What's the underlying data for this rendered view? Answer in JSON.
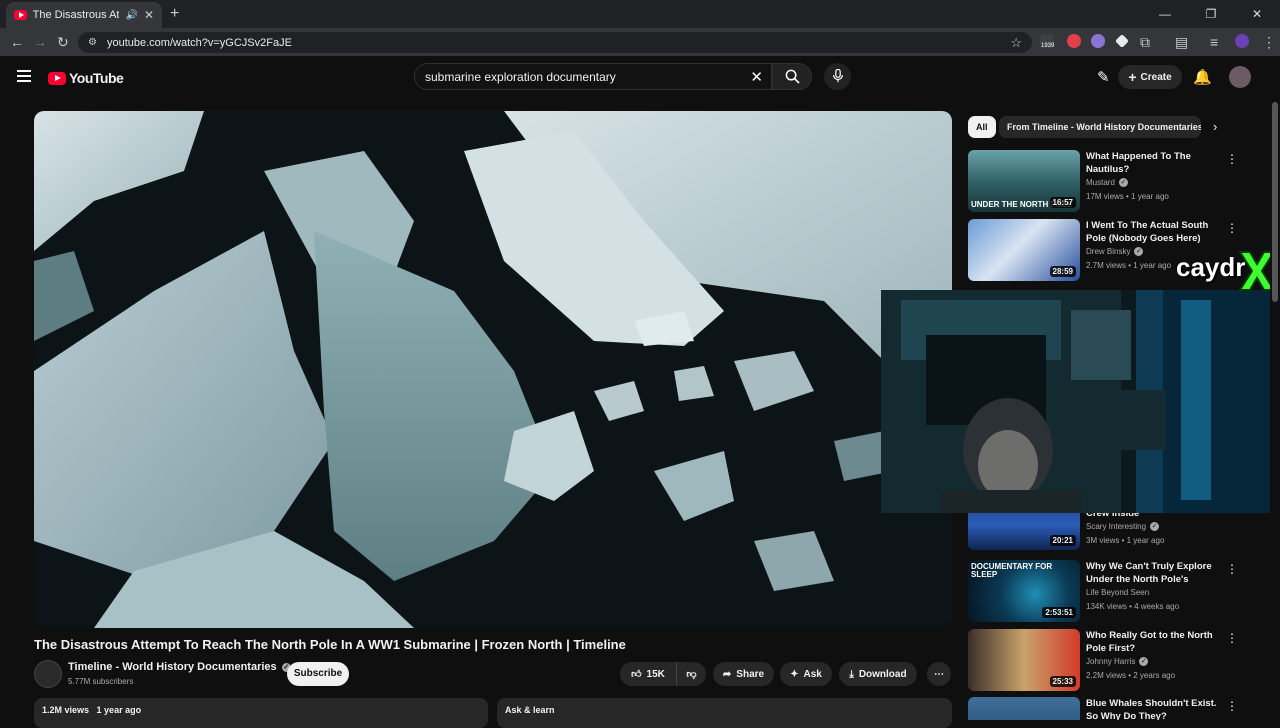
{
  "browser": {
    "tab_title": "The Disastrous Attempt To",
    "url": "youtube.com/watch?v=yGCJSv2FaJE",
    "ext_badge": "1939"
  },
  "header": {
    "logo_text": "YouTube",
    "search_value": "submarine exploration documentary",
    "create_label": "Create"
  },
  "video": {
    "title": "The Disastrous Attempt To Reach The North Pole In A WW1 Submarine | Frozen North | Timeline",
    "channel": "Timeline - World History Documentaries",
    "subscribers": "5.77M subscribers",
    "subscribe_label": "Subscribe",
    "likes": "15K",
    "share_label": "Share",
    "ask_label": "Ask",
    "download_label": "Download",
    "views": "1.2M views",
    "age": "1 year ago",
    "ask_learn_label": "Ask & learn"
  },
  "chips": {
    "all": "All",
    "timeline": "From Timeline - World History Documentaries"
  },
  "overlay": {
    "streamer_name": "caydr"
  },
  "recommendations": [
    {
      "title": "What Happened To The Nautilus?",
      "channel": "Mustard",
      "meta": "17M views • 1 year ago",
      "duration": "16:57",
      "thumb_text": "UNDER THE NORTH POLE"
    },
    {
      "title": "I Went To The Actual South Pole (Nobody Goes Here)",
      "channel": "Drew Binsky",
      "meta": "2.7M views • 1 year ago",
      "duration": "28:59",
      "thumb_text": ""
    },
    {
      "title": "Crew Inside",
      "channel": "Scary Interesting",
      "meta": "3M views • 1 year ago",
      "duration": "20:21",
      "thumb_text": ""
    },
    {
      "title": "Why We Can't Truly Explore Under the North Pole's Glacier...",
      "channel": "Life Beyond Seen",
      "meta": "134K views • 4 weeks ago",
      "duration": "2:53:51",
      "thumb_text": "DOCUMENTARY FOR SLEEP"
    },
    {
      "title": "Who Really Got to the North Pole First?",
      "channel": "Johnny Harris",
      "meta": "2.2M views • 2 years ago",
      "duration": "25:33",
      "thumb_text": ""
    },
    {
      "title": "Blue Whales Shouldn't Exist. So Why Do They?",
      "channel": "",
      "meta": "",
      "duration": "",
      "thumb_text": ""
    }
  ]
}
